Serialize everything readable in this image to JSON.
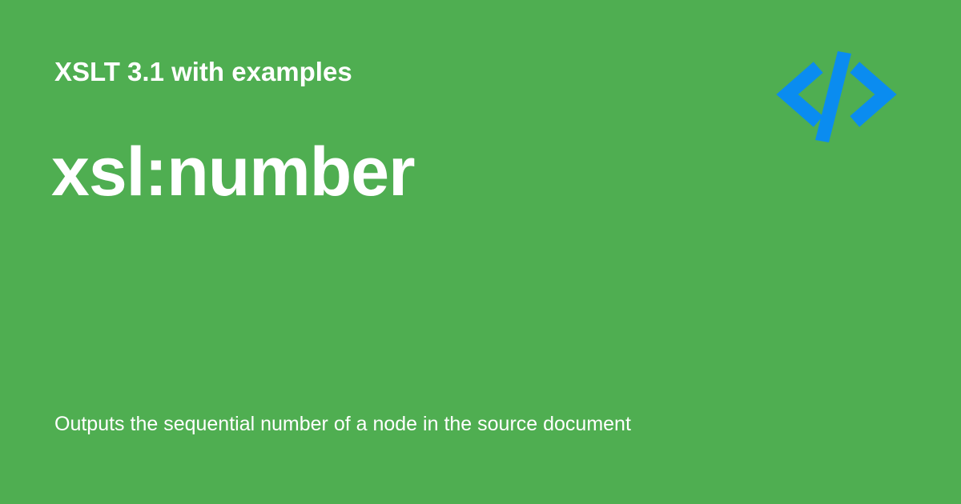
{
  "header": {
    "subtitle": "XSLT 3.1 with examples"
  },
  "main": {
    "title": "xsl:number",
    "description": "Outputs the sequential number of a node in the source document"
  },
  "logo": {
    "icon": "code-brackets-icon",
    "color": "#0a8cf0"
  },
  "colors": {
    "background": "#4fae51",
    "text": "#ffffff"
  }
}
